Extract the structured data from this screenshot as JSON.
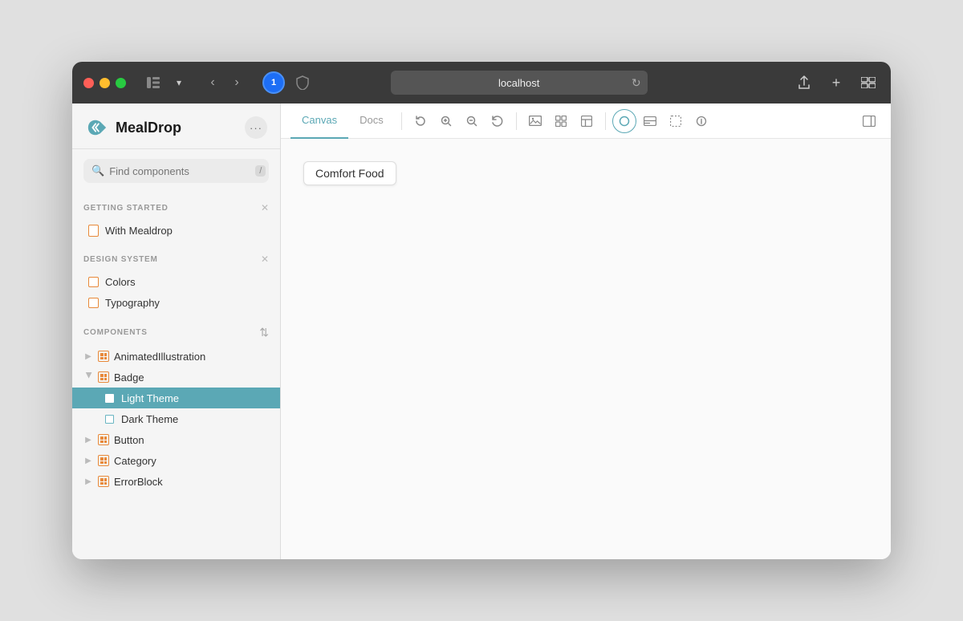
{
  "window": {
    "title": "localhost"
  },
  "titlebar": {
    "traffic_lights": [
      "red",
      "yellow",
      "green"
    ],
    "nav_back": "‹",
    "nav_forward": "›",
    "address": "localhost",
    "share_label": "Share",
    "add_label": "Add",
    "grid_label": "Grid"
  },
  "sidebar": {
    "brand_name": "MealDrop",
    "search_placeholder": "Find components",
    "search_shortcut": "/",
    "sections": [
      {
        "id": "getting-started",
        "title": "GETTING STARTED",
        "items": [
          {
            "id": "with-mealdrop",
            "label": "With Mealdrop",
            "icon": "page"
          }
        ]
      },
      {
        "id": "design-system",
        "title": "DESIGN SYSTEM",
        "items": [
          {
            "id": "colors",
            "label": "Colors",
            "icon": "component"
          },
          {
            "id": "typography",
            "label": "Typography",
            "icon": "component"
          }
        ]
      },
      {
        "id": "components",
        "title": "COMPONENTS",
        "items": [
          {
            "id": "animated-illustration",
            "label": "AnimatedIllustration",
            "icon": "component-grid",
            "expanded": false
          },
          {
            "id": "badge",
            "label": "Badge",
            "icon": "component-grid",
            "expanded": true,
            "children": [
              {
                "id": "light-theme",
                "label": "Light Theme",
                "active": true
              },
              {
                "id": "dark-theme",
                "label": "Dark Theme",
                "active": false
              }
            ]
          },
          {
            "id": "button",
            "label": "Button",
            "icon": "component-grid",
            "expanded": false
          },
          {
            "id": "category",
            "label": "Category",
            "icon": "component-grid",
            "expanded": false
          },
          {
            "id": "error-block",
            "label": "ErrorBlock",
            "icon": "component-grid",
            "expanded": false
          }
        ]
      }
    ]
  },
  "main": {
    "tabs": [
      {
        "id": "canvas",
        "label": "Canvas",
        "active": true
      },
      {
        "id": "docs",
        "label": "Docs",
        "active": false
      }
    ],
    "canvas_chip": "Comfort Food",
    "toolbar_icons": [
      "refresh",
      "zoom-in",
      "zoom-out",
      "reset",
      "image",
      "grid",
      "layout",
      "circle",
      "panel",
      "frame",
      "info",
      "sidebar-right"
    ]
  }
}
